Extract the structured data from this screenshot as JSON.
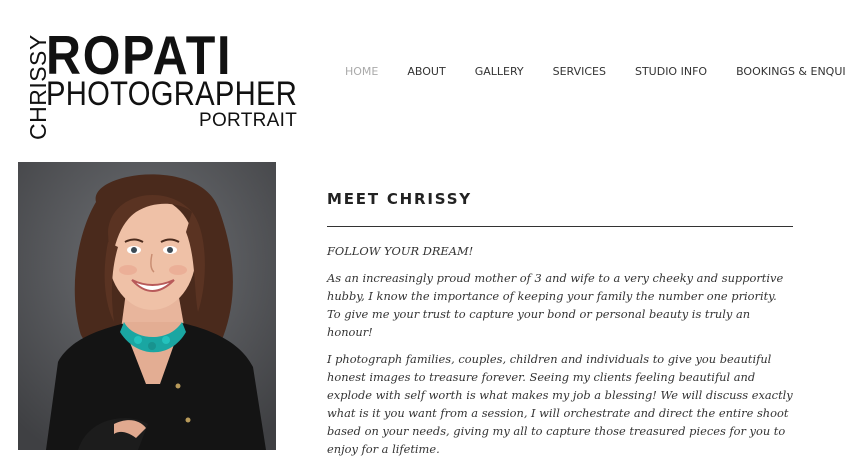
{
  "logo": {
    "vertical": "CHRISSY",
    "main": "ROPATI",
    "sub": "PHOTOGRAPHER",
    "tag": "PORTRAIT"
  },
  "nav": {
    "items": [
      {
        "label": "HOME",
        "active": true
      },
      {
        "label": "ABOUT",
        "active": false
      },
      {
        "label": "GALLERY",
        "active": false
      },
      {
        "label": "SERVICES",
        "active": false
      },
      {
        "label": "STUDIO INFO",
        "active": false
      },
      {
        "label": "BOOKINGS & ENQUIRIES",
        "active": false
      }
    ]
  },
  "main": {
    "heading": "MEET CHRISSY",
    "paragraphs": [
      "FOLLOW YOUR DREAM!",
      "As an increasingly proud mother of 3 and wife to a very cheeky and supportive hubby, I know the importance of keeping your family the number one priority. To give me your trust to capture your bond or personal beauty is truly an honour!",
      "I photograph families, couples, children and individuals to give you beautiful honest images to treasure forever. Seeing my clients feeling beautiful and explode with self worth is what makes my job a blessing! We will discuss exactly what is it you want from a session, I will orchestrate and direct the entire shoot based on your needs, giving my all to capture those treasured pieces for you to enjoy for a lifetime."
    ]
  },
  "colors": {
    "active_nav": "#aaaaaa",
    "photo_background": "#585a5d",
    "necklace": "#1aa6a2"
  }
}
